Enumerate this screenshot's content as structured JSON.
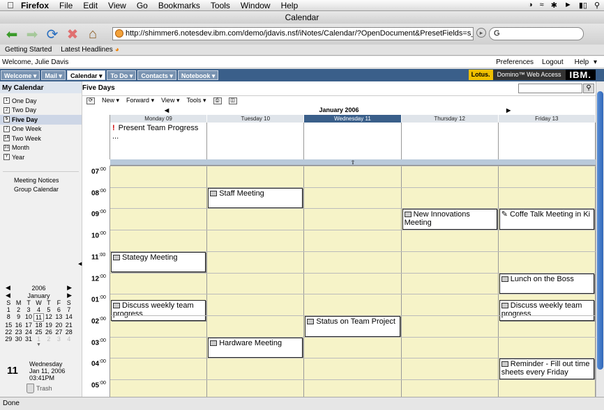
{
  "menubar": {
    "app": "Firefox",
    "items": [
      "File",
      "Edit",
      "View",
      "Go",
      "Bookmarks",
      "Tools",
      "Window",
      "Help"
    ]
  },
  "window": {
    "title": "Calendar"
  },
  "nav": {
    "url": "http://shimmer6.notesdev.ibm.com/demo/jdavis.nsf/iNotes/Calendar/?OpenDocument&PresetFields=s_CalVie",
    "search_value": "G"
  },
  "bookmarks": [
    "Getting Started",
    "Latest Headlines"
  ],
  "header": {
    "welcome": "Welcome, Julie Davis",
    "links": [
      "Preferences",
      "Logout",
      "Help"
    ]
  },
  "tabs": [
    "Welcome",
    "Mail",
    "Calendar",
    "To Do",
    "Contacts",
    "Notebook"
  ],
  "brand": {
    "lotus": "Lotus.",
    "product": "Domino™ Web Access",
    "ibm": "IBM."
  },
  "sidebar": {
    "title": "My Calendar",
    "views": [
      "One Day",
      "Two Day",
      "Five Day",
      "One Week",
      "Two Week",
      "Month",
      "Year"
    ],
    "selected_view": "Five Day",
    "links": [
      "Meeting Notices",
      "Group Calendar"
    ],
    "mini_cal": {
      "year": "2006",
      "month": "January",
      "weekdays": [
        "S",
        "M",
        "T",
        "W",
        "T",
        "F",
        "S"
      ],
      "days": [
        "1",
        "2",
        "3",
        "4",
        "5",
        "6",
        "7",
        "8",
        "9",
        "10",
        "11",
        "12",
        "13",
        "14",
        "15",
        "16",
        "17",
        "18",
        "19",
        "20",
        "21",
        "22",
        "23",
        "24",
        "25",
        "26",
        "27",
        "28",
        "29",
        "30",
        "31",
        "1",
        "2",
        "3",
        "4"
      ],
      "today": "11"
    },
    "today_box": {
      "day": "11",
      "weekday": "Wednesday",
      "date": "Jan 11, 2006",
      "time": "03:41PM"
    },
    "trash": "Trash"
  },
  "main": {
    "title": "Five Days",
    "toolbar": [
      "New",
      "Forward",
      "View",
      "Tools"
    ],
    "month_label": "January 2006",
    "days": [
      "Monday 09",
      "Tuesday 10",
      "Wednesday 11",
      "Thursday 12",
      "Friday 13"
    ],
    "today_index": 2,
    "allday_event": {
      "title": "Present Team Progress",
      "more": "..."
    },
    "hours": [
      {
        "h": "07",
        "m": ":00"
      },
      {
        "h": "08",
        "m": ":00"
      },
      {
        "h": "09",
        "m": ":00"
      },
      {
        "h": "10",
        "m": ":00"
      },
      {
        "h": "11",
        "m": ":00"
      },
      {
        "h": "12",
        "m": ":00"
      },
      {
        "h": "01",
        "m": ":00"
      },
      {
        "h": "02",
        "m": ":00"
      },
      {
        "h": "03",
        "m": ":00"
      },
      {
        "h": "04",
        "m": ":00"
      },
      {
        "h": "05",
        "m": ":00"
      }
    ],
    "events": [
      {
        "day": 1,
        "start": 1,
        "title": "Staff Meeting",
        "icon": "meeting"
      },
      {
        "day": 3,
        "start": 2,
        "title": "New Innovations Meeting",
        "icon": "meeting"
      },
      {
        "day": 4,
        "start": 2,
        "title": "Coffe Talk Meeting in Ki",
        "icon": "pencil"
      },
      {
        "day": 0,
        "start": 4,
        "title": "Stategy Meeting",
        "icon": "meeting"
      },
      {
        "day": 4,
        "start": 5,
        "title": "Lunch on the Boss",
        "icon": "meeting"
      },
      {
        "day": 0,
        "start": 6.25,
        "title": "Discuss weekly team progress",
        "icon": "meeting"
      },
      {
        "day": 4,
        "start": 6.25,
        "title": "Discuss weekly team progress",
        "icon": "meeting"
      },
      {
        "day": 2,
        "start": 7,
        "title": "Status on Team Project",
        "icon": "meeting"
      },
      {
        "day": 1,
        "start": 8,
        "title": "Hardware Meeting",
        "icon": "meeting"
      },
      {
        "day": 4,
        "start": 9,
        "title": "Reminder - Fill out time sheets every Friday",
        "icon": "meeting"
      }
    ]
  },
  "status": "Done"
}
